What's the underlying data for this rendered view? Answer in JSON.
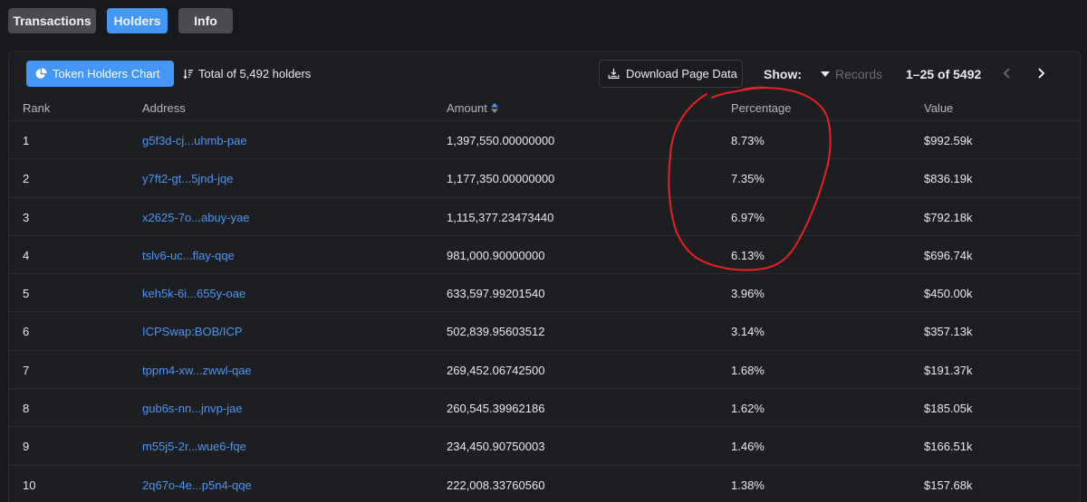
{
  "tabs": [
    {
      "label": "Transactions",
      "active": false
    },
    {
      "label": "Holders",
      "active": true
    },
    {
      "label": "Info",
      "active": false
    }
  ],
  "toolbar": {
    "chart_button": "Token Holders Chart",
    "total": "Total of 5,492 holders",
    "download": "Download Page Data",
    "show_label": "Show:",
    "records": "Records",
    "range": "1–25 of 5492"
  },
  "table": {
    "headers": {
      "rank": "Rank",
      "address": "Address",
      "amount": "Amount",
      "percentage": "Percentage",
      "value": "Value"
    },
    "rows": [
      {
        "rank": "1",
        "address": "g5f3d-cj...uhmb-pae",
        "amount": "1,397,550.00000000",
        "percentage": "8.73%",
        "value": "$992.59k"
      },
      {
        "rank": "2",
        "address": "y7ft2-gt...5jnd-jqe",
        "amount": "1,177,350.00000000",
        "percentage": "7.35%",
        "value": "$836.19k"
      },
      {
        "rank": "3",
        "address": "x2625-7o...abuy-yae",
        "amount": "1,115,377.23473440",
        "percentage": "6.97%",
        "value": "$792.18k"
      },
      {
        "rank": "4",
        "address": "tslv6-uc...flay-qqe",
        "amount": "981,000.90000000",
        "percentage": "6.13%",
        "value": "$696.74k"
      },
      {
        "rank": "5",
        "address": "keh5k-6i...655y-oae",
        "amount": "633,597.99201540",
        "percentage": "3.96%",
        "value": "$450.00k"
      },
      {
        "rank": "6",
        "address": "ICPSwap:BOB/ICP",
        "amount": "502,839.95603512",
        "percentage": "3.14%",
        "value": "$357.13k"
      },
      {
        "rank": "7",
        "address": "tppm4-xw...zwwl-qae",
        "amount": "269,452.06742500",
        "percentage": "1.68%",
        "value": "$191.37k"
      },
      {
        "rank": "8",
        "address": "gub6s-nn...jnvp-jae",
        "amount": "260,545.39962186",
        "percentage": "1.62%",
        "value": "$185.05k"
      },
      {
        "rank": "9",
        "address": "m55j5-2r...wue6-fqe",
        "amount": "234,450.90750003",
        "percentage": "1.46%",
        "value": "$166.51k"
      },
      {
        "rank": "10",
        "address": "2q67o-4e...p5n4-qqe",
        "amount": "222,008.33760560",
        "percentage": "1.38%",
        "value": "$157.68k"
      }
    ]
  },
  "colors": {
    "accent": "#4597f7",
    "link": "#4d96f3",
    "annotation": "#e8201f"
  }
}
